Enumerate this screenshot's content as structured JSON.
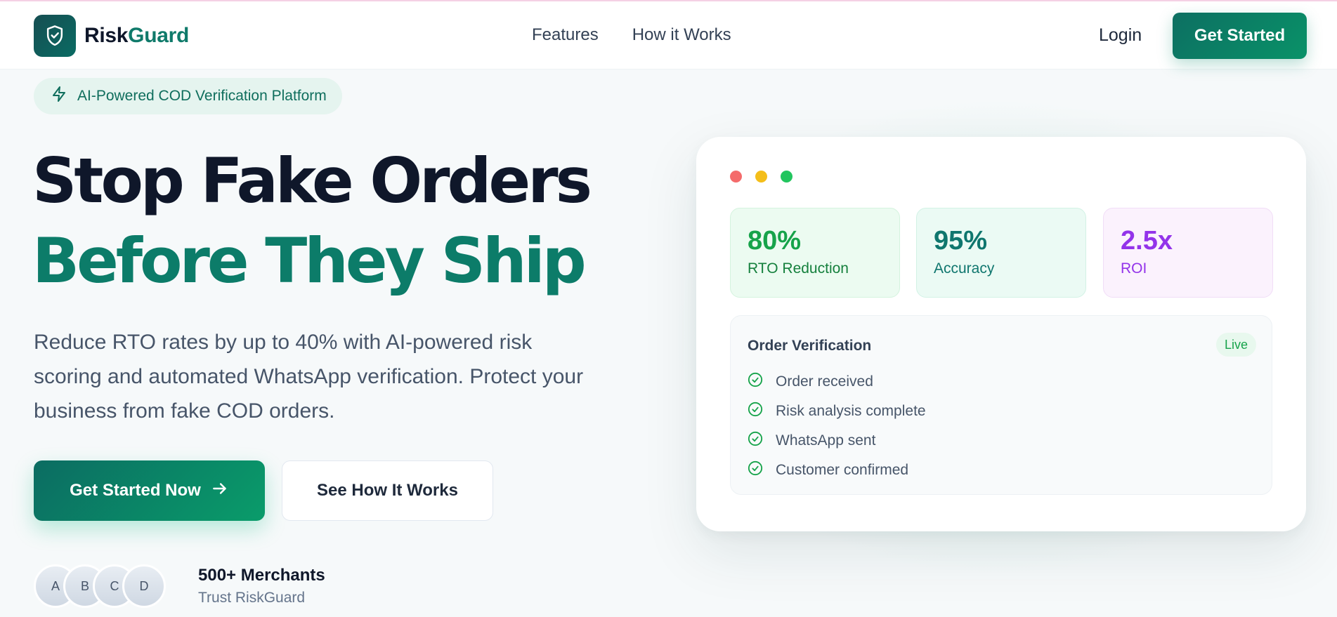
{
  "brand": {
    "name_part1": "Risk",
    "name_part2": "Guard"
  },
  "nav": {
    "links": [
      "Features",
      "How it Works"
    ],
    "login": "Login",
    "cta": "Get Started"
  },
  "hero": {
    "badge": "AI-Powered COD Verification Platform",
    "title_line1": "Stop Fake Orders",
    "title_line2": "Before They Ship",
    "lead_line1": "Reduce RTO rates by up to 40% with AI-powered risk",
    "lead_line2": "scoring and automated WhatsApp verification. Protect your",
    "lead_line3": "business from fake COD orders.",
    "primary_cta": "Get Started Now",
    "secondary_cta": "See How It Works",
    "avatars": [
      "A",
      "B",
      "C",
      "D"
    ],
    "merchants_title": "500+ Merchants",
    "merchants_sub": "Trust RiskGuard"
  },
  "card": {
    "stats": [
      {
        "value": "80%",
        "label": "RTO Reduction"
      },
      {
        "value": "95%",
        "label": "Accuracy"
      },
      {
        "value": "2.5x",
        "label": "ROI"
      }
    ],
    "verification": {
      "title": "Order Verification",
      "status": "Live",
      "steps": [
        "Order received",
        "Risk analysis complete",
        "WhatsApp sent",
        "Customer confirmed"
      ]
    }
  },
  "colors": {
    "brand_teal": "#0c7c69",
    "heading_dark": "#0f172a",
    "green": "#16a34a",
    "purple": "#9333ea",
    "dot_red": "#f46b6b",
    "dot_yellow": "#f4be1a",
    "dot_green": "#22c55e"
  },
  "icons": {
    "logo": "shield-check-icon",
    "badge": "lightning-icon",
    "cta_arrow": "arrow-right-icon",
    "step": "check-circle-icon"
  }
}
